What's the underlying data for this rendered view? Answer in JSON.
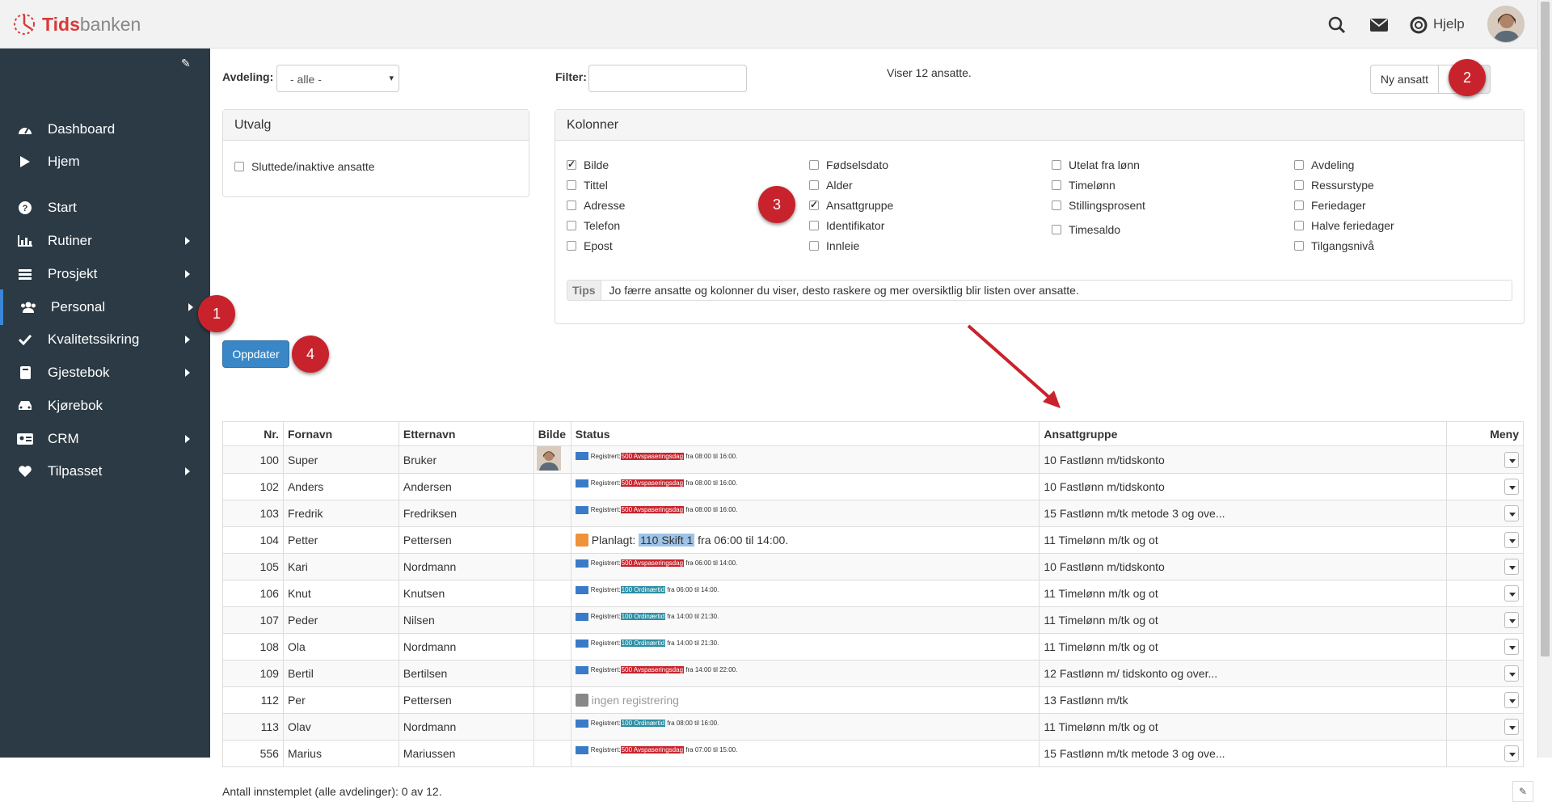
{
  "brand": {
    "logo_bold": "Tids",
    "logo_rest": "banken"
  },
  "topbar": {
    "help_label": "Hjelp"
  },
  "sidebar": {
    "items": [
      {
        "label": "Dashboard",
        "icon": "dashboard-icon",
        "arrow": false
      },
      {
        "label": "Hjem",
        "icon": "play-icon",
        "arrow": false
      },
      {
        "label": "Start",
        "icon": "question-icon",
        "arrow": false
      },
      {
        "label": "Rutiner",
        "icon": "bar-chart-icon",
        "arrow": true
      },
      {
        "label": "Prosjekt",
        "icon": "list-icon",
        "arrow": true
      },
      {
        "label": "Personal",
        "icon": "users-icon",
        "arrow": true,
        "active": true
      },
      {
        "label": "Kvalitetssikring",
        "icon": "check-icon",
        "arrow": true
      },
      {
        "label": "Gjestebok",
        "icon": "book-icon",
        "arrow": true
      },
      {
        "label": "Kjørebok",
        "icon": "car-icon",
        "arrow": false
      },
      {
        "label": "CRM",
        "icon": "id-card-icon",
        "arrow": true
      },
      {
        "label": "Tilpasset",
        "icon": "heart-icon",
        "arrow": true
      }
    ]
  },
  "filters": {
    "department_label": "Avdeling:",
    "department_value": "- alle -",
    "filter_label": "Filter:",
    "filter_value": "",
    "showing": "Viser 12 ansatte.",
    "new_employee": "Ny ansatt"
  },
  "utvalg": {
    "title": "Utvalg",
    "option": "Sluttede/inaktive ansatte"
  },
  "kolonner": {
    "title": "Kolonner",
    "columns": [
      [
        {
          "label": "Bilde",
          "checked": true
        },
        {
          "label": "Tittel",
          "checked": false
        },
        {
          "label": "Adresse",
          "checked": false
        },
        {
          "label": "Telefon",
          "checked": false
        },
        {
          "label": "Epost",
          "checked": false
        }
      ],
      [
        {
          "label": "Fødselsdato",
          "checked": false
        },
        {
          "label": "Alder",
          "checked": false
        },
        {
          "label": "Ansattgruppe",
          "checked": true
        },
        {
          "label": "Identifikator",
          "checked": false
        },
        {
          "label": "Innleie",
          "checked": false
        }
      ],
      [
        {
          "label": "Utelat fra lønn",
          "checked": false
        },
        {
          "label": "Timelønn",
          "checked": false
        },
        {
          "label": "Stillingsprosent",
          "checked": false
        },
        {
          "label": "Timesaldo",
          "checked": false
        }
      ],
      [
        {
          "label": "Avdeling",
          "checked": false
        },
        {
          "label": "Ressurstype",
          "checked": false
        },
        {
          "label": "Feriedager",
          "checked": false
        },
        {
          "label": "Halve feriedager",
          "checked": false
        },
        {
          "label": "Tilgangsnivå",
          "checked": false
        }
      ]
    ],
    "tips_label": "Tips",
    "tips_text": "Jo færre ansatte og kolonner du viser, desto raskere og mer oversiktlig blir listen over ansatte."
  },
  "update_button": "Oppdater",
  "markers": [
    "1",
    "2",
    "3",
    "4"
  ],
  "table": {
    "headers": {
      "nr": "Nr.",
      "first": "Fornavn",
      "last": "Etternavn",
      "photo": "Bilde",
      "status": "Status",
      "group": "Ansattgruppe",
      "menu": "Meny"
    },
    "rows": [
      {
        "nr": "100",
        "first": "Super",
        "last": "Bruker",
        "photo": true,
        "status_type": "reg",
        "prefix": "Registrert:",
        "code": "500 Avspaseringsdag",
        "code_color": "red",
        "time": "fra 08:00 til 16:00.",
        "group": "10 Fastlønn m/tidskonto"
      },
      {
        "nr": "102",
        "first": "Anders",
        "last": "Andersen",
        "photo": false,
        "status_type": "reg",
        "prefix": "Registrert:",
        "code": "500 Avspaseringsdag",
        "code_color": "red",
        "time": "fra 08:00 til 16:00.",
        "group": "10 Fastlønn m/tidskonto"
      },
      {
        "nr": "103",
        "first": "Fredrik",
        "last": "Fredriksen",
        "photo": false,
        "status_type": "reg",
        "prefix": "Registrert:",
        "code": "500 Avspaseringsdag",
        "code_color": "red",
        "time": "fra 08:00 til 16:00.",
        "group": "15 Fastlønn m/tk metode 3 og ove..."
      },
      {
        "nr": "104",
        "first": "Petter",
        "last": "Pettersen",
        "photo": false,
        "status_type": "plan",
        "prefix": "Planlagt:",
        "code": "110 Skift 1",
        "time": "fra 06:00 til 14:00.",
        "group": "11 Timelønn m/tk og ot"
      },
      {
        "nr": "105",
        "first": "Kari",
        "last": "Nordmann",
        "photo": false,
        "status_type": "reg",
        "prefix": "Registrert:",
        "code": "500 Avspaseringsdag",
        "code_color": "red",
        "time": "fra 06:00 til 14:00.",
        "group": "10 Fastlønn m/tidskonto"
      },
      {
        "nr": "106",
        "first": "Knut",
        "last": "Knutsen",
        "photo": false,
        "status_type": "reg",
        "prefix": "Registrert:",
        "code": "100 Ordinærtid",
        "code_color": "blue",
        "time": "fra 06:00 til 14:00.",
        "group": "11 Timelønn m/tk og ot"
      },
      {
        "nr": "107",
        "first": "Peder",
        "last": "Nilsen",
        "photo": false,
        "status_type": "reg",
        "prefix": "Registrert:",
        "code": "100 Ordinærtid",
        "code_color": "blue",
        "time": "fra 14:00 til 21:30.",
        "group": "11 Timelønn m/tk og ot"
      },
      {
        "nr": "108",
        "first": "Ola",
        "last": "Nordmann",
        "photo": false,
        "status_type": "reg",
        "prefix": "Registrert:",
        "code": "100 Ordinærtid",
        "code_color": "blue",
        "time": "fra 14:00 til 21:30.",
        "group": "11 Timelønn m/tk og ot"
      },
      {
        "nr": "109",
        "first": "Bertil",
        "last": "Bertilsen",
        "photo": false,
        "status_type": "reg",
        "prefix": "Registrert:",
        "code": "500 Avspaseringsdag",
        "code_color": "red",
        "time": "fra 14:00 til 22:00.",
        "group": "12 Fastlønn m/ tidskonto og over..."
      },
      {
        "nr": "112",
        "first": "Per",
        "last": "Pettersen",
        "photo": false,
        "status_type": "none",
        "prefix": "ingen registrering",
        "group": "13 Fastlønn m/tk"
      },
      {
        "nr": "113",
        "first": "Olav",
        "last": "Nordmann",
        "photo": false,
        "status_type": "reg",
        "prefix": "Registrert:",
        "code": "100 Ordinærtid",
        "code_color": "blue",
        "time": "fra 08:00 til 16:00.",
        "group": "11 Timelønn m/tk og ot"
      },
      {
        "nr": "556",
        "first": "Marius",
        "last": "Mariussen",
        "photo": false,
        "status_type": "reg",
        "prefix": "Registrert:",
        "code": "500 Avspaseringsdag",
        "code_color": "red",
        "time": "fra 07:00 til 15:00.",
        "group": "15 Fastlønn m/tk metode 3 og ove..."
      }
    ]
  },
  "footer": "Antall innstemplet (alle avdelinger): 0 av 12.",
  "colors": {
    "sidebar": "#2b3a44",
    "accent": "#3a87c7",
    "marker": "#c8232c",
    "red_code": "#c8232c",
    "blue_code": "#2b8fa4"
  }
}
